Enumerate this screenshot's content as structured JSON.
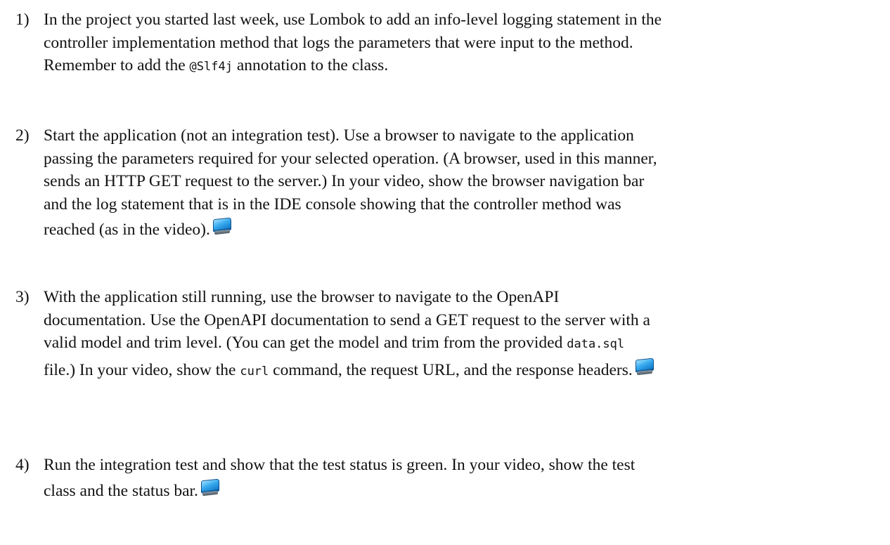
{
  "items": [
    {
      "number": "1)",
      "line1": "In the project you started last week, use Lombok to add an info-level logging statement in the",
      "line2": "controller implementation method that logs the parameters that were input to the method.",
      "line3_before": "Remember to add the ",
      "line3_code": "@Slf4j",
      "line3_after": " annotation to the class."
    },
    {
      "number": "2)",
      "line1": "Start the application (not an integration test). Use a browser to navigate to the application",
      "line2": "passing the parameters required for your selected operation. (A browser, used in this manner,",
      "line3": "sends an HTTP GET request to the server.)  In your video, show the browser navigation bar",
      "line4": "and the log statement that is in the IDE console showing that the controller method was",
      "line5": "reached (as in the video).",
      "icon": "monitor-icon"
    },
    {
      "number": "3)",
      "line1": "With the application still running, use the browser to navigate to the OpenAPI",
      "line2": "documentation. Use the OpenAPI documentation to send a GET request to the server with a",
      "line3_before": "valid model and trim level. (You can get the model and trim from the provided ",
      "line3_code": "data.sql",
      "line4_before": "file.) In your video, show the ",
      "line4_code": "curl",
      "line4_after": " command, the request URL, and the response headers.",
      "icon": "monitor-icon"
    },
    {
      "number": "4)",
      "line1": "Run the integration test and show that the test status is green. In your video, show the test",
      "line2": "class and the status bar.",
      "icon": "monitor-icon"
    }
  ]
}
